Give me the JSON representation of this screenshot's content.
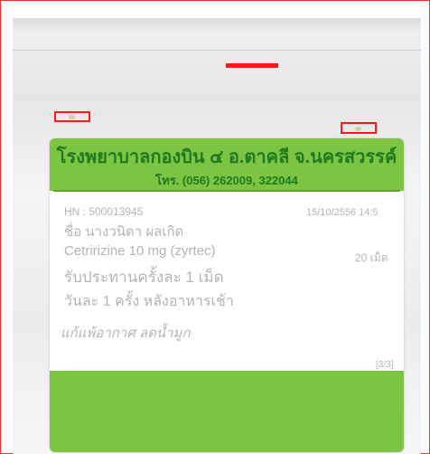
{
  "label": {
    "hospital_name": "โรงพยาบาลกองบิน ๔   อ.ตาคลี  จ.นครสวรรค์",
    "phone": "โทร. (056) 262009, 322044",
    "hn": "HN : 500013945",
    "date_time": "15/10/2556  14:5",
    "patient_name": "ชื่อ นางวนิดา ผลเกิด",
    "drug": "Cetririzine 10 mg (zyrtec)",
    "quantity": "20 เม็ด",
    "direction_1": "รับประทานครั้งละ 1 เม็ด",
    "direction_2": "วันละ 1 ครั้ง หลังอาหารเช้า",
    "indication": "แก้แพ้อากาศ ลดน้ำมูก",
    "page": "[3/3]"
  },
  "colors": {
    "label_green": "#7dc442",
    "header_text": "#1f7a1f",
    "annotation_red": "#ff1a1a",
    "print_gray": "#b4b4b4"
  }
}
